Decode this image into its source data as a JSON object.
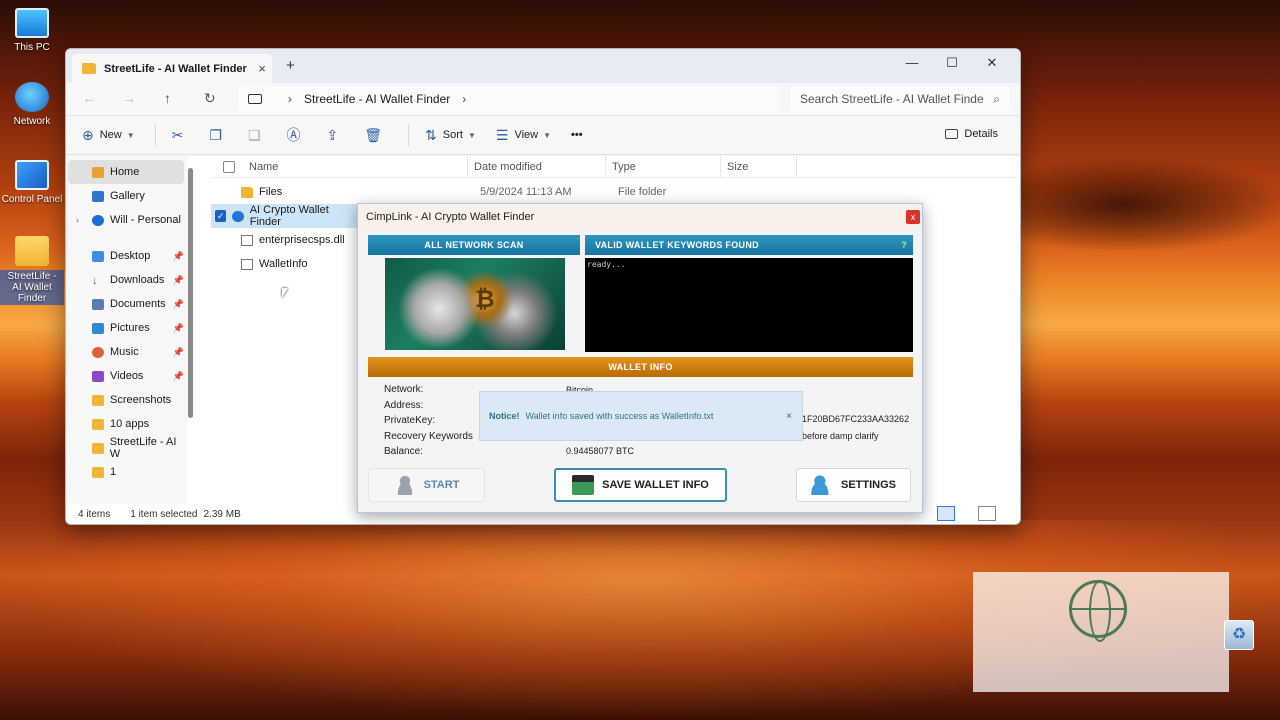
{
  "desktop": {
    "icons": [
      {
        "label": "This PC"
      },
      {
        "label": "Network"
      },
      {
        "label": "Control Panel"
      },
      {
        "label": "StreetLife - AI Wallet Finder"
      }
    ]
  },
  "explorer": {
    "tab_title": "StreetLife - AI Wallet Finder",
    "tab_close": "×",
    "new_tab": "+",
    "window_controls": {
      "minimize": "—",
      "maximize": "☐",
      "close": "✕"
    },
    "nav": {
      "back": "←",
      "forward": "→",
      "up": "↑",
      "refresh": "↻"
    },
    "address": {
      "path": "StreetLife - AI Wallet Finder"
    },
    "search": {
      "placeholder": "Search StreetLife - AI Wallet Finde"
    },
    "toolbar": {
      "new_label": "New",
      "sort_label": "Sort",
      "view_label": "View",
      "more_label": "•••",
      "details_label": "Details"
    },
    "sidebar": {
      "items": [
        {
          "label": "Home"
        },
        {
          "label": "Gallery"
        },
        {
          "label": "Will - Personal"
        },
        {
          "label": "Desktop"
        },
        {
          "label": "Downloads"
        },
        {
          "label": "Documents"
        },
        {
          "label": "Pictures"
        },
        {
          "label": "Music"
        },
        {
          "label": "Videos"
        },
        {
          "label": "Screenshots"
        },
        {
          "label": "10 apps"
        },
        {
          "label": "StreetLife - AI W"
        },
        {
          "label": "1"
        }
      ]
    },
    "columns": {
      "name": "Name",
      "date": "Date modified",
      "type": "Type",
      "size": "Size"
    },
    "files": [
      {
        "name": "Files",
        "date": "5/9/2024 11:13 AM",
        "type": "File folder"
      },
      {
        "name": "AI Crypto Wallet Finder"
      },
      {
        "name": "enterprisecsps.dll"
      },
      {
        "name": "WalletInfo"
      }
    ],
    "status": {
      "count": "4 items",
      "selected": "1 item selected",
      "size": "2.39 MB"
    }
  },
  "dialog": {
    "title": "CimpLink - AI Crypto Wallet Finder",
    "close": "x",
    "scan_header": "ALL NETWORK SCAN",
    "keywords_header": "VALID WALLET KEYWORDS FOUND",
    "keywords_help": "?",
    "console_text": "ready...",
    "wallet_info_header": "WALLET INFO",
    "labels": {
      "network": "Network:",
      "address": "Address:",
      "private_key": "PrivateKey:",
      "recovery": "Recovery Keywords",
      "balance": "Balance:"
    },
    "values": {
      "network": "Bitcoin",
      "private_key": "1F20BD67FC233AA33262",
      "recovery": "before damp clarify",
      "balance": "0.94458077 BTC"
    },
    "notice": {
      "title": "Notice!",
      "message": "Wallet info saved with success as WalletInfo.txt",
      "close": "×"
    },
    "buttons": {
      "start": "START",
      "save": "SAVE WALLET INFO",
      "settings": "SETTINGS"
    }
  }
}
